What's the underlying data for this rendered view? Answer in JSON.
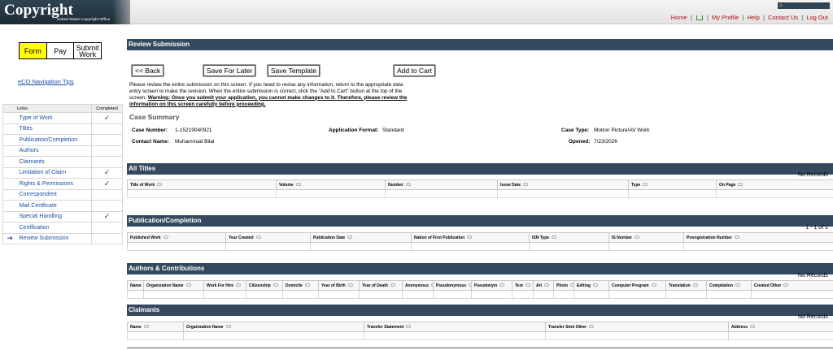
{
  "header": {
    "logo_text": "Copyright",
    "logo_sub": "United States Copyright Office",
    "top_strip_icon": "home-icon",
    "nav": [
      "Home",
      "My Profile",
      "Help",
      "Contact Us",
      "Log Out"
    ]
  },
  "sidebar": {
    "tabs": [
      {
        "label": "Form",
        "active": true
      },
      {
        "label": "Pay",
        "active": false
      },
      {
        "label": "Submit Work",
        "active": false
      }
    ],
    "nav_tips": "eCO Navigation Tips",
    "table_header": {
      "links": "Links",
      "completed": "Completed"
    },
    "items": [
      {
        "label": "Type of Work",
        "completed": "✓"
      },
      {
        "label": "Titles",
        "completed": ""
      },
      {
        "label": "Publication/Completion",
        "completed": ""
      },
      {
        "label": "Authors",
        "completed": ""
      },
      {
        "label": "Claimants",
        "completed": ""
      },
      {
        "label": "Limitation of Claim",
        "completed": "✓"
      },
      {
        "label": "Rights & Permissions",
        "completed": "✓"
      },
      {
        "label": "Correspondent",
        "completed": ""
      },
      {
        "label": "Mail Certificate",
        "completed": ""
      },
      {
        "label": "Special Handling",
        "completed": "✓"
      },
      {
        "label": "Certification",
        "completed": ""
      },
      {
        "label": "Review Submission",
        "completed": "",
        "current": true
      }
    ]
  },
  "review": {
    "title": "Review Submission",
    "buttons": {
      "back": "<< Back",
      "save_later": "Save For Later",
      "save_template": "Save Template",
      "add_cart": "Add to Cart"
    },
    "intro_1": "Please review the entire submission on this screen. If you need to revise any information, return to the appropriate data entry screen to make the revision. When the entire submission is correct, click the \"Add to Cart\" button at the top of the screen.",
    "intro_warning": "Warning: Once you submit your application, you cannot make changes to it. Therefore, please review the information on this screen carefully before proceeding."
  },
  "case_summary": {
    "title": "Case Summary",
    "case_number_label": "Case Number:",
    "case_number": "1-15219040921",
    "contact_label": "Contact Name:",
    "contact": "Muhammad Bilal",
    "format_label": "Application Format:",
    "format": "Standard",
    "case_type_label": "Case Type:",
    "case_type": "Motion Picture/AV Work",
    "opened_label": "Opened:",
    "opened": "7/23/2026"
  },
  "titles": {
    "title": "All Titles",
    "records": "No Records",
    "columns": [
      "Title of Work",
      "Volume",
      "Number",
      "Issue Date",
      "Type",
      "On Page"
    ]
  },
  "publication": {
    "title": "Publication/Completion",
    "records": "1 - 1 of 1",
    "columns": [
      "Published Work",
      "Year Created",
      "Publication Date",
      "Nation of First Publication",
      "ISN Type",
      "IS Number",
      "Preregistration Number"
    ]
  },
  "authors": {
    "title": "Authors & Contributions",
    "records": "No Records",
    "columns": [
      "Name",
      "Organization Name",
      "Work For Hire",
      "Citizenship",
      "Domicile",
      "Year of Birth",
      "Year of Death",
      "Anonymous",
      "Pseudonymous",
      "Pseudonym",
      "Text",
      "Art",
      "Photo",
      "Editing",
      "Computer Program",
      "Translation",
      "Compilation",
      "Created Other"
    ]
  },
  "claimants": {
    "title": "Claimants",
    "records": "No Records",
    "columns": [
      "Name",
      "Organization Name",
      "Transfer Statement",
      "Transfer Stmt Other",
      "Address"
    ]
  }
}
